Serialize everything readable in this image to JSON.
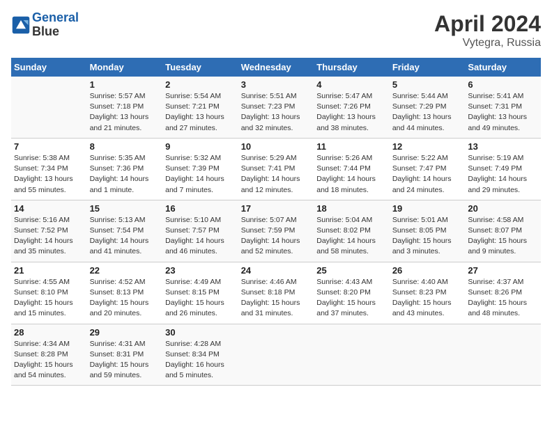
{
  "header": {
    "logo_line1": "General",
    "logo_line2": "Blue",
    "title": "April 2024",
    "subtitle": "Vytegra, Russia"
  },
  "weekdays": [
    "Sunday",
    "Monday",
    "Tuesday",
    "Wednesday",
    "Thursday",
    "Friday",
    "Saturday"
  ],
  "weeks": [
    [
      {
        "num": "",
        "info": ""
      },
      {
        "num": "1",
        "info": "Sunrise: 5:57 AM\nSunset: 7:18 PM\nDaylight: 13 hours\nand 21 minutes."
      },
      {
        "num": "2",
        "info": "Sunrise: 5:54 AM\nSunset: 7:21 PM\nDaylight: 13 hours\nand 27 minutes."
      },
      {
        "num": "3",
        "info": "Sunrise: 5:51 AM\nSunset: 7:23 PM\nDaylight: 13 hours\nand 32 minutes."
      },
      {
        "num": "4",
        "info": "Sunrise: 5:47 AM\nSunset: 7:26 PM\nDaylight: 13 hours\nand 38 minutes."
      },
      {
        "num": "5",
        "info": "Sunrise: 5:44 AM\nSunset: 7:29 PM\nDaylight: 13 hours\nand 44 minutes."
      },
      {
        "num": "6",
        "info": "Sunrise: 5:41 AM\nSunset: 7:31 PM\nDaylight: 13 hours\nand 49 minutes."
      }
    ],
    [
      {
        "num": "7",
        "info": "Sunrise: 5:38 AM\nSunset: 7:34 PM\nDaylight: 13 hours\nand 55 minutes."
      },
      {
        "num": "8",
        "info": "Sunrise: 5:35 AM\nSunset: 7:36 PM\nDaylight: 14 hours\nand 1 minute."
      },
      {
        "num": "9",
        "info": "Sunrise: 5:32 AM\nSunset: 7:39 PM\nDaylight: 14 hours\nand 7 minutes."
      },
      {
        "num": "10",
        "info": "Sunrise: 5:29 AM\nSunset: 7:41 PM\nDaylight: 14 hours\nand 12 minutes."
      },
      {
        "num": "11",
        "info": "Sunrise: 5:26 AM\nSunset: 7:44 PM\nDaylight: 14 hours\nand 18 minutes."
      },
      {
        "num": "12",
        "info": "Sunrise: 5:22 AM\nSunset: 7:47 PM\nDaylight: 14 hours\nand 24 minutes."
      },
      {
        "num": "13",
        "info": "Sunrise: 5:19 AM\nSunset: 7:49 PM\nDaylight: 14 hours\nand 29 minutes."
      }
    ],
    [
      {
        "num": "14",
        "info": "Sunrise: 5:16 AM\nSunset: 7:52 PM\nDaylight: 14 hours\nand 35 minutes."
      },
      {
        "num": "15",
        "info": "Sunrise: 5:13 AM\nSunset: 7:54 PM\nDaylight: 14 hours\nand 41 minutes."
      },
      {
        "num": "16",
        "info": "Sunrise: 5:10 AM\nSunset: 7:57 PM\nDaylight: 14 hours\nand 46 minutes."
      },
      {
        "num": "17",
        "info": "Sunrise: 5:07 AM\nSunset: 7:59 PM\nDaylight: 14 hours\nand 52 minutes."
      },
      {
        "num": "18",
        "info": "Sunrise: 5:04 AM\nSunset: 8:02 PM\nDaylight: 14 hours\nand 58 minutes."
      },
      {
        "num": "19",
        "info": "Sunrise: 5:01 AM\nSunset: 8:05 PM\nDaylight: 15 hours\nand 3 minutes."
      },
      {
        "num": "20",
        "info": "Sunrise: 4:58 AM\nSunset: 8:07 PM\nDaylight: 15 hours\nand 9 minutes."
      }
    ],
    [
      {
        "num": "21",
        "info": "Sunrise: 4:55 AM\nSunset: 8:10 PM\nDaylight: 15 hours\nand 15 minutes."
      },
      {
        "num": "22",
        "info": "Sunrise: 4:52 AM\nSunset: 8:13 PM\nDaylight: 15 hours\nand 20 minutes."
      },
      {
        "num": "23",
        "info": "Sunrise: 4:49 AM\nSunset: 8:15 PM\nDaylight: 15 hours\nand 26 minutes."
      },
      {
        "num": "24",
        "info": "Sunrise: 4:46 AM\nSunset: 8:18 PM\nDaylight: 15 hours\nand 31 minutes."
      },
      {
        "num": "25",
        "info": "Sunrise: 4:43 AM\nSunset: 8:20 PM\nDaylight: 15 hours\nand 37 minutes."
      },
      {
        "num": "26",
        "info": "Sunrise: 4:40 AM\nSunset: 8:23 PM\nDaylight: 15 hours\nand 43 minutes."
      },
      {
        "num": "27",
        "info": "Sunrise: 4:37 AM\nSunset: 8:26 PM\nDaylight: 15 hours\nand 48 minutes."
      }
    ],
    [
      {
        "num": "28",
        "info": "Sunrise: 4:34 AM\nSunset: 8:28 PM\nDaylight: 15 hours\nand 54 minutes."
      },
      {
        "num": "29",
        "info": "Sunrise: 4:31 AM\nSunset: 8:31 PM\nDaylight: 15 hours\nand 59 minutes."
      },
      {
        "num": "30",
        "info": "Sunrise: 4:28 AM\nSunset: 8:34 PM\nDaylight: 16 hours\nand 5 minutes."
      },
      {
        "num": "",
        "info": ""
      },
      {
        "num": "",
        "info": ""
      },
      {
        "num": "",
        "info": ""
      },
      {
        "num": "",
        "info": ""
      }
    ]
  ]
}
